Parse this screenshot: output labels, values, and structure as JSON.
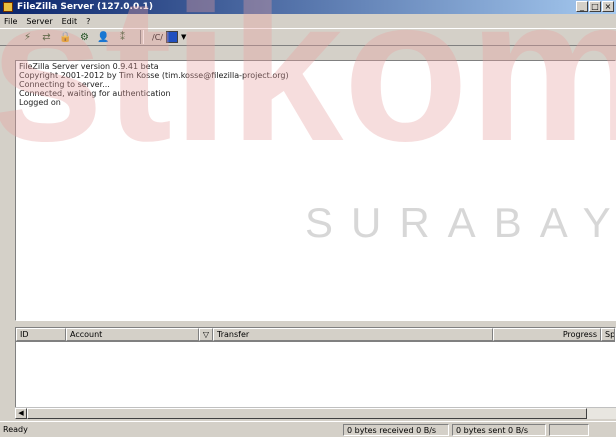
{
  "window": {
    "title": "FileZilla Server (127.0.0.1)"
  },
  "title_controls": [
    "_",
    "□",
    "×"
  ],
  "menu": [
    "File",
    "Server",
    "Edit",
    "?"
  ],
  "toolbar": {
    "active_label": "/C/",
    "icons": [
      "connect-icon",
      "disconnect-icon",
      "lock-icon",
      "settings-icon",
      "users-icon",
      "groups-icon"
    ]
  },
  "log_lines": [
    "FileZilla Server version 0.9.41 beta",
    "Copyright 2001-2012 by Tim Kosse (tim.kosse@filezilla-project.org)",
    "Connecting to server...",
    "Connected, waiting for authentication",
    "Logged on"
  ],
  "list": {
    "columns": [
      "ID",
      "Account",
      "",
      "Transfer",
      "Progress",
      "Sp"
    ],
    "sort_indicator": "▽"
  },
  "status": {
    "ready": "Ready",
    "received": "0 bytes received 0 B/s",
    "sent": "0 bytes sent 0 B/s"
  },
  "watermark": {
    "big": "stikom",
    "small": "SURABAYA",
    "color": "#e8a0a0"
  }
}
